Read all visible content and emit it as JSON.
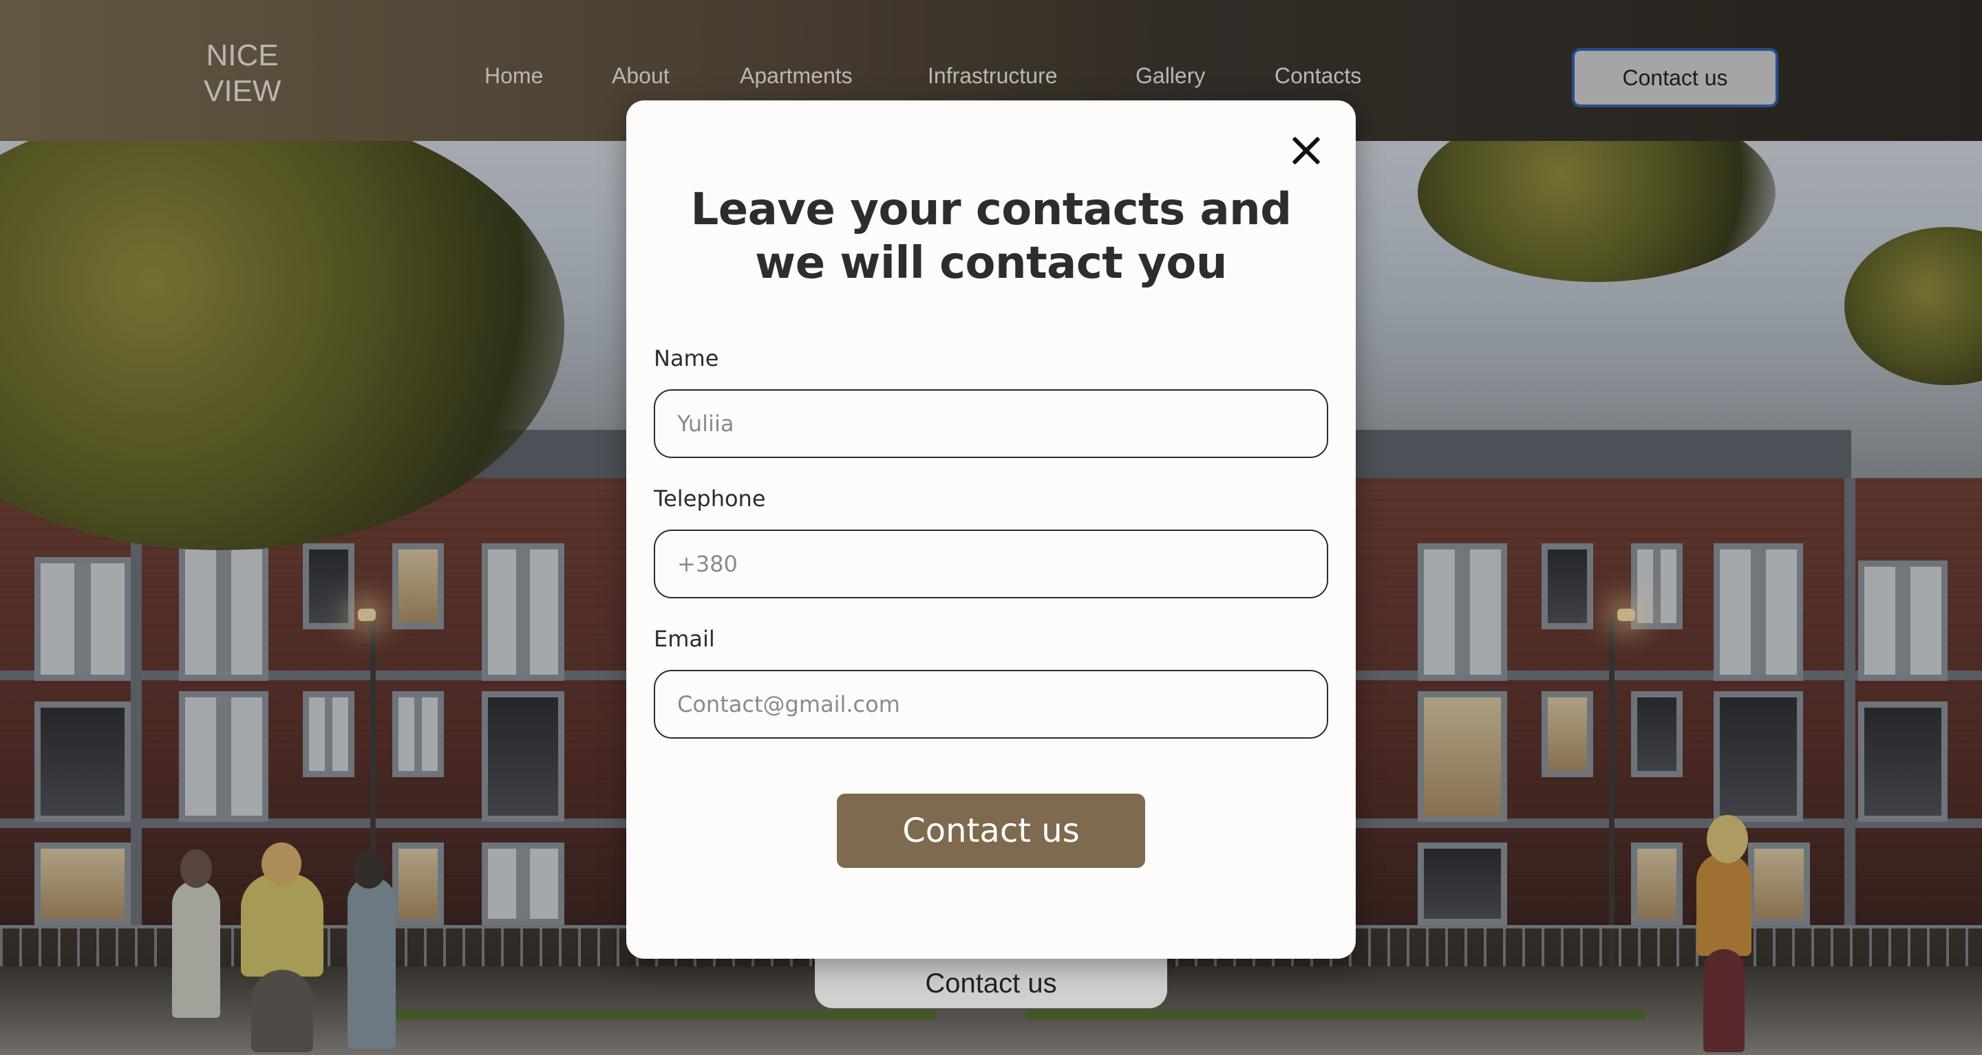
{
  "header": {
    "logo_line1": "NICE",
    "logo_line2": "VIEW",
    "nav": [
      {
        "label": "Home"
      },
      {
        "label": "About"
      },
      {
        "label": "Apartments"
      },
      {
        "label": "Infrastructure"
      },
      {
        "label": "Gallery"
      },
      {
        "label": "Contacts"
      }
    ],
    "cta_label": "Contact us"
  },
  "hero": {
    "cta_label": "Contact us"
  },
  "modal": {
    "title": "Leave your contacts and we will contact you",
    "name_label": "Name",
    "name_placeholder": "Yuliia",
    "phone_label": "Telephone",
    "phone_placeholder": "+380",
    "email_label": "Email",
    "email_placeholder": "Contact@gmail.com",
    "submit_label": "Contact us"
  },
  "colors": {
    "brand_brown": "#7e6a4e",
    "header_gradient_start": "#7a6a51",
    "focus_outline": "#2c5fb3"
  }
}
